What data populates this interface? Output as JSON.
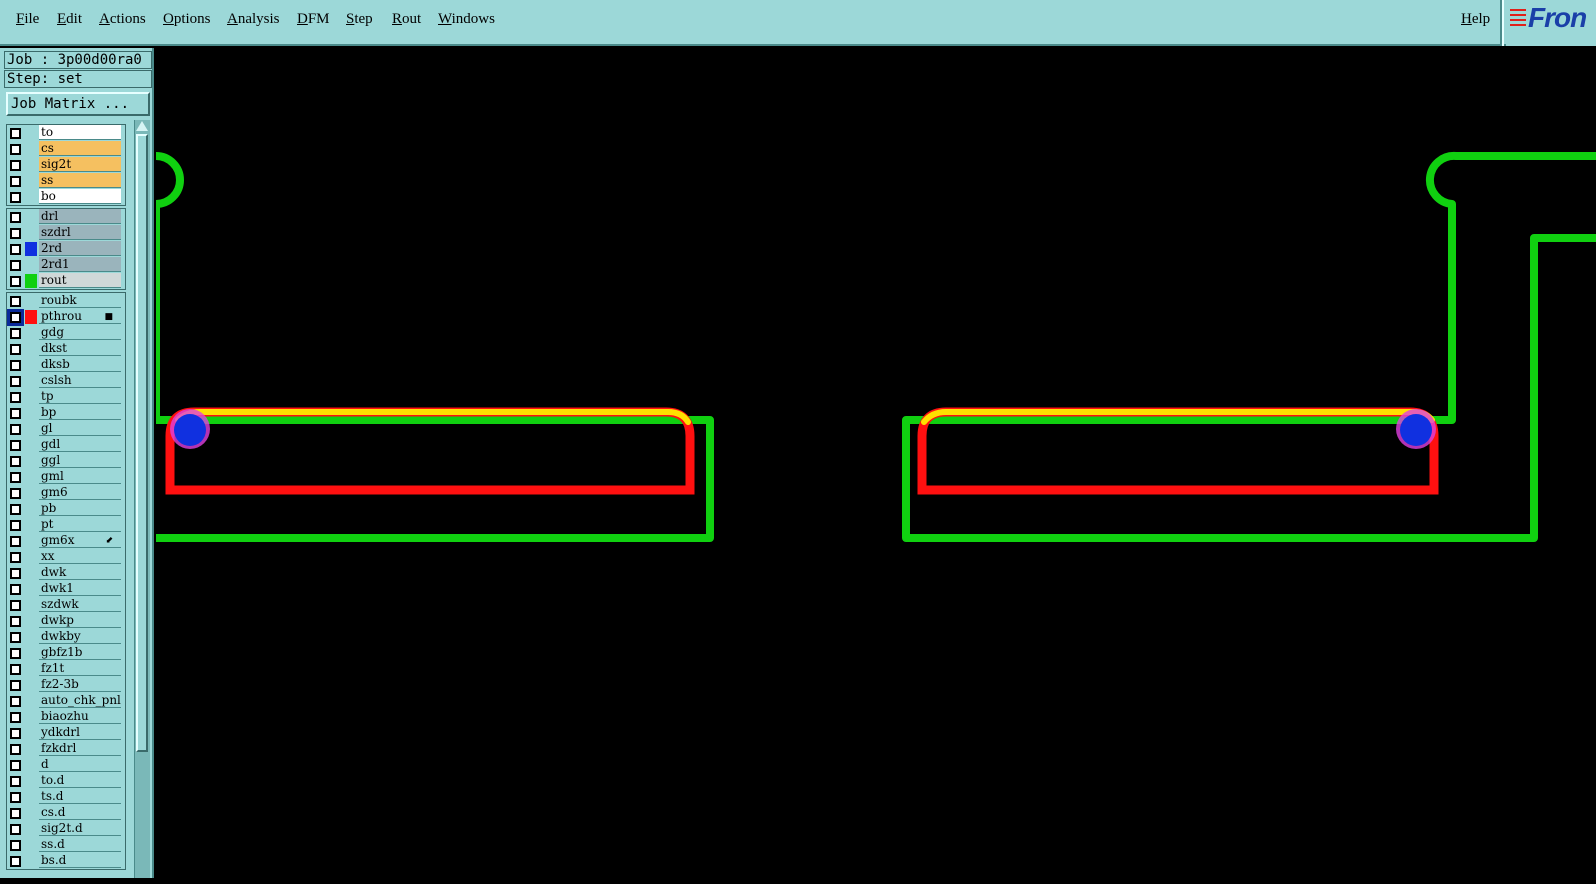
{
  "menubar": {
    "items": [
      "File",
      "Edit",
      "Actions",
      "Options",
      "Analysis",
      "DFM",
      "Step",
      "Rout",
      "Windows"
    ],
    "help": "Help"
  },
  "logo": {
    "text": "Fron"
  },
  "sidebar": {
    "job": "Job : 3p00d00ra0",
    "step": "Step: set",
    "job_matrix": "Job Matrix ..."
  },
  "layers": [
    {
      "name": "to",
      "bg": "#ffffff",
      "color": ""
    },
    {
      "name": "cs",
      "bg": "#f5c060",
      "color": ""
    },
    {
      "name": "sig2t",
      "bg": "#f5c060",
      "color": ""
    },
    {
      "name": "ss",
      "bg": "#f5c060",
      "color": ""
    },
    {
      "name": "bo",
      "bg": "#ffffff",
      "color": ""
    },
    {
      "name": "drl",
      "bg": "#9ab4bc",
      "color": ""
    },
    {
      "name": "szdrl",
      "bg": "#9ab4bc",
      "color": ""
    },
    {
      "name": "2rd",
      "bg": "#9ab4bc",
      "color": "#1030e0"
    },
    {
      "name": "2rd1",
      "bg": "#9ab4bc",
      "color": ""
    },
    {
      "name": "rout",
      "bg": "#d0d8d8",
      "color": "#10d010"
    },
    {
      "name": "roubk",
      "bg": "#9cd8d8",
      "color": ""
    },
    {
      "name": "pthrou",
      "bg": "#9cd8d8",
      "color": "#ff1010",
      "active": true,
      "mark": "■"
    },
    {
      "name": "gdg",
      "bg": "#9cd8d8",
      "color": ""
    },
    {
      "name": "dkst",
      "bg": "#9cd8d8",
      "color": ""
    },
    {
      "name": "dksb",
      "bg": "#9cd8d8",
      "color": ""
    },
    {
      "name": "cslsh",
      "bg": "#9cd8d8",
      "color": ""
    },
    {
      "name": "tp",
      "bg": "#9cd8d8",
      "color": ""
    },
    {
      "name": "bp",
      "bg": "#9cd8d8",
      "color": ""
    },
    {
      "name": "gl",
      "bg": "#9cd8d8",
      "color": ""
    },
    {
      "name": "gdl",
      "bg": "#9cd8d8",
      "color": ""
    },
    {
      "name": "ggl",
      "bg": "#9cd8d8",
      "color": ""
    },
    {
      "name": "gml",
      "bg": "#9cd8d8",
      "color": ""
    },
    {
      "name": "gm6",
      "bg": "#9cd8d8",
      "color": ""
    },
    {
      "name": "pb",
      "bg": "#9cd8d8",
      "color": ""
    },
    {
      "name": "pt",
      "bg": "#9cd8d8",
      "color": ""
    },
    {
      "name": "gm6x",
      "bg": "#9cd8d8",
      "color": "",
      "mark": "⬋"
    },
    {
      "name": "xx",
      "bg": "#9cd8d8",
      "color": ""
    },
    {
      "name": "dwk",
      "bg": "#9cd8d8",
      "color": ""
    },
    {
      "name": "dwk1",
      "bg": "#9cd8d8",
      "color": ""
    },
    {
      "name": "szdwk",
      "bg": "#9cd8d8",
      "color": ""
    },
    {
      "name": "dwkp",
      "bg": "#9cd8d8",
      "color": ""
    },
    {
      "name": "dwkby",
      "bg": "#9cd8d8",
      "color": ""
    },
    {
      "name": "gbfz1b",
      "bg": "#9cd8d8",
      "color": ""
    },
    {
      "name": "fz1t",
      "bg": "#9cd8d8",
      "color": ""
    },
    {
      "name": "fz2-3b",
      "bg": "#9cd8d8",
      "color": ""
    },
    {
      "name": "auto_chk_pnl",
      "bg": "#9cd8d8",
      "color": ""
    },
    {
      "name": "biaozhu",
      "bg": "#9cd8d8",
      "color": ""
    },
    {
      "name": "ydkdrl",
      "bg": "#9cd8d8",
      "color": ""
    },
    {
      "name": "fzkdrl",
      "bg": "#9cd8d8",
      "color": ""
    },
    {
      "name": "d",
      "bg": "#9cd8d8",
      "color": ""
    },
    {
      "name": "to.d",
      "bg": "#9cd8d8",
      "color": ""
    },
    {
      "name": "ts.d",
      "bg": "#9cd8d8",
      "color": ""
    },
    {
      "name": "cs.d",
      "bg": "#9cd8d8",
      "color": ""
    },
    {
      "name": "sig2t.d",
      "bg": "#9cd8d8",
      "color": ""
    },
    {
      "name": "ss.d",
      "bg": "#9cd8d8",
      "color": ""
    },
    {
      "name": "bs.d",
      "bg": "#9cd8d8",
      "color": ""
    }
  ],
  "canvas_colors": {
    "rout": "#10d010",
    "pthrou": "#ff1010",
    "overlap": "#ffe000",
    "drill": "#1030e0",
    "drill_halo": "#e040e0"
  }
}
